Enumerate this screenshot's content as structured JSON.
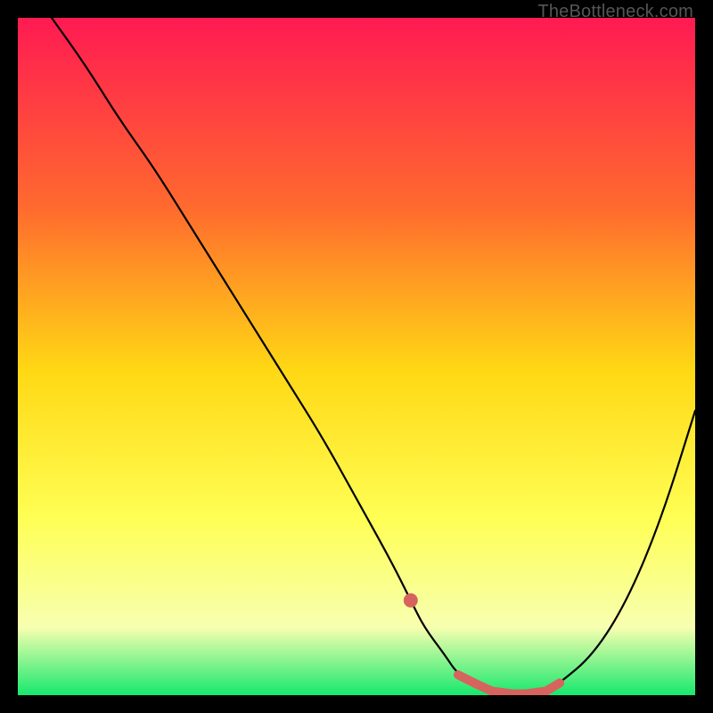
{
  "watermark": "TheBottleneck.com",
  "colors": {
    "gradient_top": "#ff1a52",
    "gradient_mid1": "#ff6a2e",
    "gradient_mid2": "#ffd814",
    "gradient_mid3": "#ffff55",
    "gradient_mid4": "#f7ffb0",
    "gradient_bottom": "#17e86e",
    "curve": "#000000",
    "highlight_dot": "#d6635e",
    "highlight_stroke": "#d6635e",
    "frame": "#000000"
  },
  "chart_data": {
    "type": "line",
    "title": "",
    "xlabel": "",
    "ylabel": "",
    "xlim": [
      0,
      100
    ],
    "ylim": [
      0,
      100
    ],
    "grid": false,
    "legend": false,
    "series": [
      {
        "name": "curve",
        "x": [
          5,
          10,
          15,
          20,
          25,
          30,
          35,
          40,
          45,
          50,
          55,
          58,
          60,
          63,
          65,
          68,
          70,
          73,
          75,
          78,
          80,
          85,
          90,
          95,
          100
        ],
        "y": [
          100,
          93,
          85,
          78,
          70,
          62,
          54,
          46,
          38,
          29,
          20,
          14,
          10,
          6,
          3,
          1.5,
          0.6,
          0.2,
          0.2,
          0.6,
          1.8,
          6,
          14,
          26,
          42
        ]
      }
    ],
    "annotations": [
      {
        "name": "highlight-dot",
        "x": 58,
        "y": 14
      },
      {
        "name": "highlight-segment",
        "x0": 65,
        "x1": 80,
        "y0": 3,
        "y1": 1.8
      }
    ]
  }
}
